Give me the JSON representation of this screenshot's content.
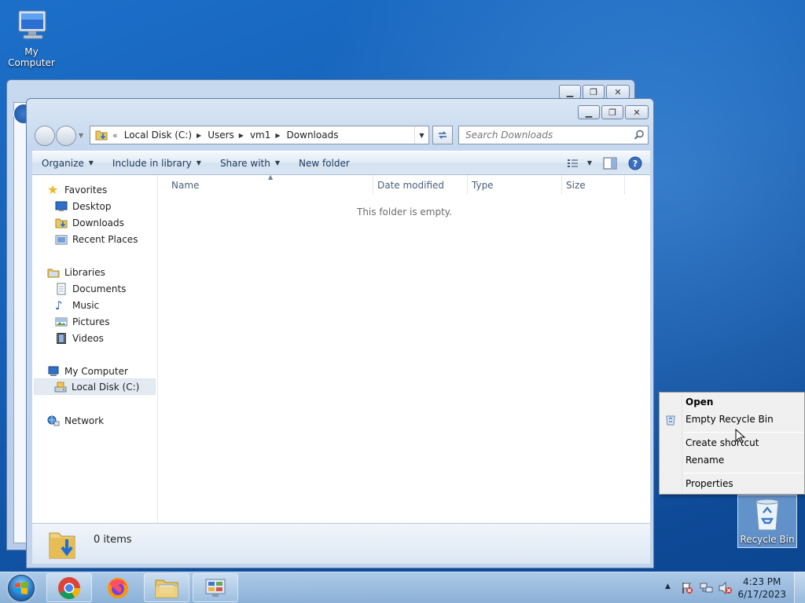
{
  "desktop": {
    "my_computer_label": "My Computer",
    "recycle_bin_label": "Recycle Bin"
  },
  "explorer": {
    "breadcrumb": {
      "overflow": "«",
      "items": [
        "Local Disk (C:)",
        "Users",
        "vm1",
        "Downloads"
      ]
    },
    "search_placeholder": "Search Downloads",
    "toolbar": {
      "organize": "Organize",
      "include_in_library": "Include in library",
      "share_with": "Share with",
      "new_folder": "New folder"
    },
    "nav_pane": {
      "favorites": "Favorites",
      "desktop": "Desktop",
      "downloads": "Downloads",
      "recent_places": "Recent Places",
      "libraries": "Libraries",
      "documents": "Documents",
      "music": "Music",
      "pictures": "Pictures",
      "videos": "Videos",
      "my_computer": "My Computer",
      "local_disk": "Local Disk (C:)",
      "network": "Network"
    },
    "columns": [
      "Name",
      "Date modified",
      "Type",
      "Size"
    ],
    "empty_message": "This folder is empty.",
    "item_count": "0 items"
  },
  "context_menu": {
    "open": "Open",
    "empty_recycle_bin": "Empty Recycle Bin",
    "create_shortcut": "Create shortcut",
    "rename": "Rename",
    "properties": "Properties"
  },
  "taskbar": {
    "time": "4:23 PM",
    "date": "6/17/2023"
  },
  "colors": {
    "desktop_blue": "#1561b8",
    "toolbar_text": "#1e395b",
    "selection_bg": "#e4eaf2"
  }
}
